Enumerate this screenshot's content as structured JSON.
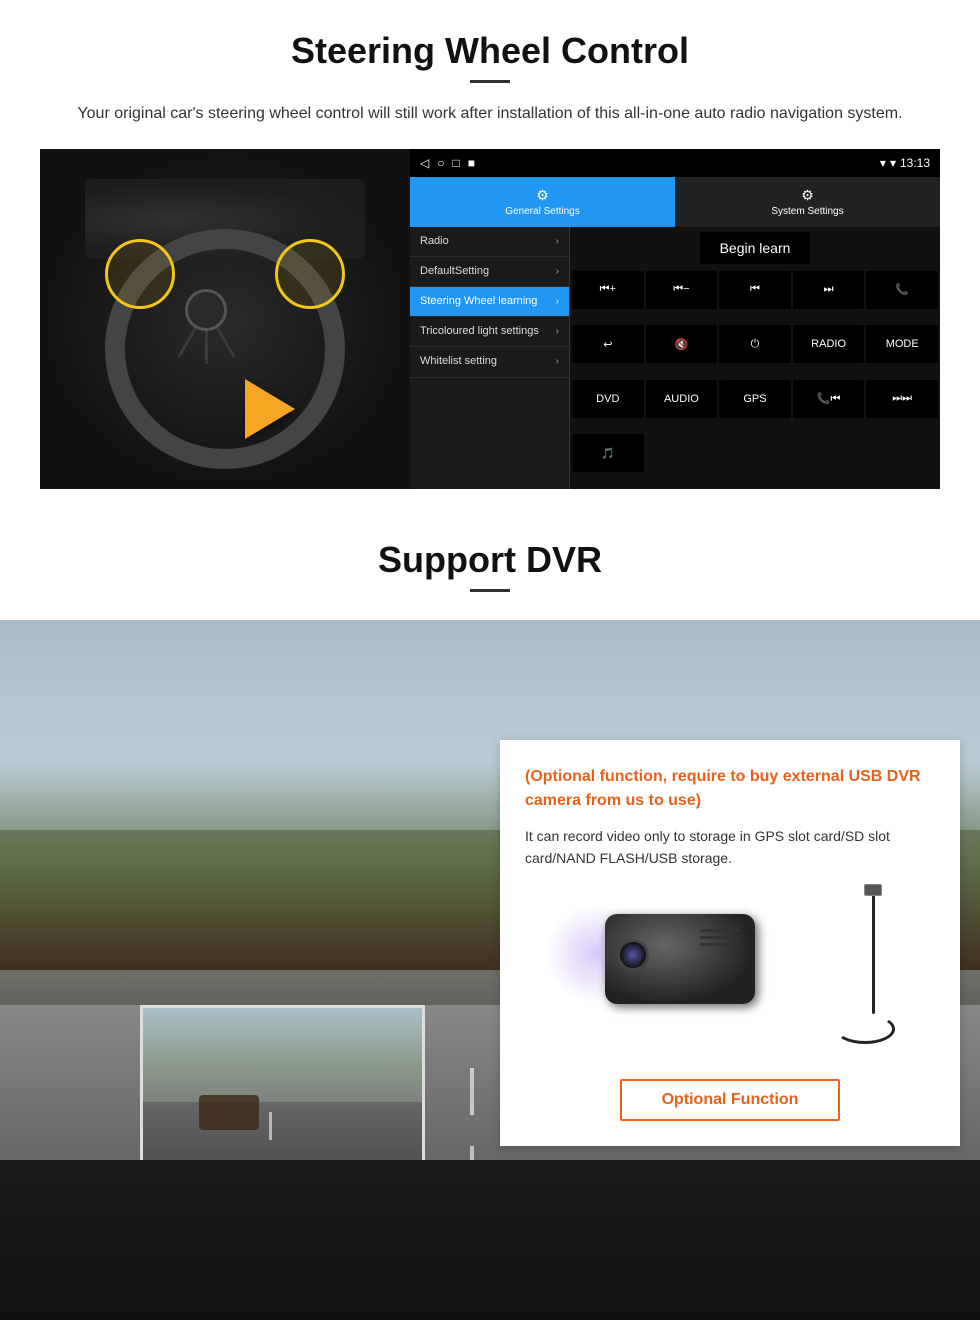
{
  "steering_section": {
    "title": "Steering Wheel Control",
    "description": "Your original car's steering wheel control will still work after installation of this all-in-one auto radio navigation system.",
    "android_ui": {
      "statusbar": {
        "time": "13:13",
        "signal_icon": "▼",
        "wifi_icon": "▾"
      },
      "nav_icons": [
        "◁",
        "○",
        "□",
        "■"
      ],
      "tabs": [
        {
          "label": "General Settings",
          "icon": "⚙",
          "active": true
        },
        {
          "label": "System Settings",
          "icon": "🔧",
          "active": false
        }
      ],
      "menu_items": [
        {
          "label": "Radio",
          "active": false
        },
        {
          "label": "DefaultSetting",
          "active": false
        },
        {
          "label": "Steering Wheel learning",
          "active": true
        },
        {
          "label": "Tricoloured light settings",
          "active": false
        },
        {
          "label": "Whitelist setting",
          "active": false
        }
      ],
      "begin_learn_label": "Begin learn",
      "control_buttons": [
        "⏮+",
        "⏮−",
        "⏮⏮",
        "⏭⏭",
        "📞",
        "↩",
        "🔇",
        "⏻",
        "RADIO",
        "MODE",
        "DVD",
        "AUDIO",
        "GPS",
        "📞⏮",
        "⏭⏭"
      ]
    }
  },
  "dvr_section": {
    "title": "Support DVR",
    "optional_text": "(Optional function, require to buy external USB DVR camera from us to use)",
    "description": "It can record video only to storage in GPS slot card/SD slot card/NAND FLASH/USB storage.",
    "optional_function_label": "Optional Function"
  }
}
